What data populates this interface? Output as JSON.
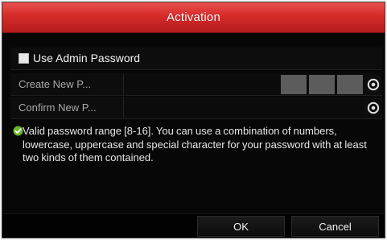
{
  "dialog": {
    "title": "Activation"
  },
  "use_admin_password": {
    "label": "Use Admin Password",
    "checked": false
  },
  "create_password": {
    "label": "Create New P...",
    "value": "",
    "strength_segments": 3
  },
  "confirm_password": {
    "label": "Confirm New P...",
    "value": ""
  },
  "hint": {
    "text": "Valid password range [8-16]. You can use a combination of numbers, lowercase, uppercase and special character for your password with at least two kinds of them contained."
  },
  "buttons": {
    "ok": "OK",
    "cancel": "Cancel"
  },
  "colors": {
    "title_bar": "#d72b2a",
    "background": "#070707",
    "hint_icon": "#6ab52c"
  },
  "icons": {
    "show_password": "eye-icon",
    "hint": "check-shield-icon"
  }
}
